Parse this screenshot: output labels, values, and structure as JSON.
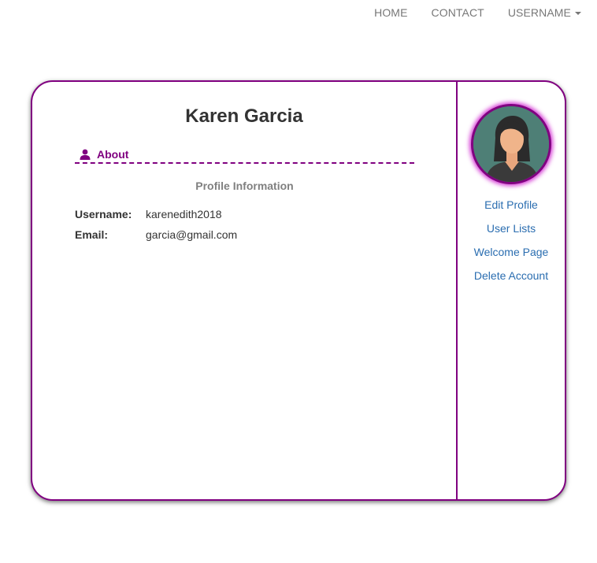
{
  "nav": {
    "home": "HOME",
    "contact": "CONTACT",
    "username": "USERNAME"
  },
  "profile": {
    "name": "Karen Garcia",
    "about_label": "About",
    "section_title": "Profile Information",
    "username_label": "Username:",
    "username_value": "karenedith2018",
    "email_label": "Email:",
    "email_value": "garcia@gmail.com"
  },
  "sidebar": {
    "links": [
      {
        "label": "Edit Profile"
      },
      {
        "label": "User Lists"
      },
      {
        "label": "Welcome Page"
      },
      {
        "label": "Delete Account"
      }
    ]
  },
  "colors": {
    "accent": "#800080",
    "link": "#2a6db0",
    "nav_text": "#777777"
  },
  "icons": {
    "about": "user-icon",
    "dropdown": "caret-down-icon",
    "avatar": "female-avatar"
  }
}
